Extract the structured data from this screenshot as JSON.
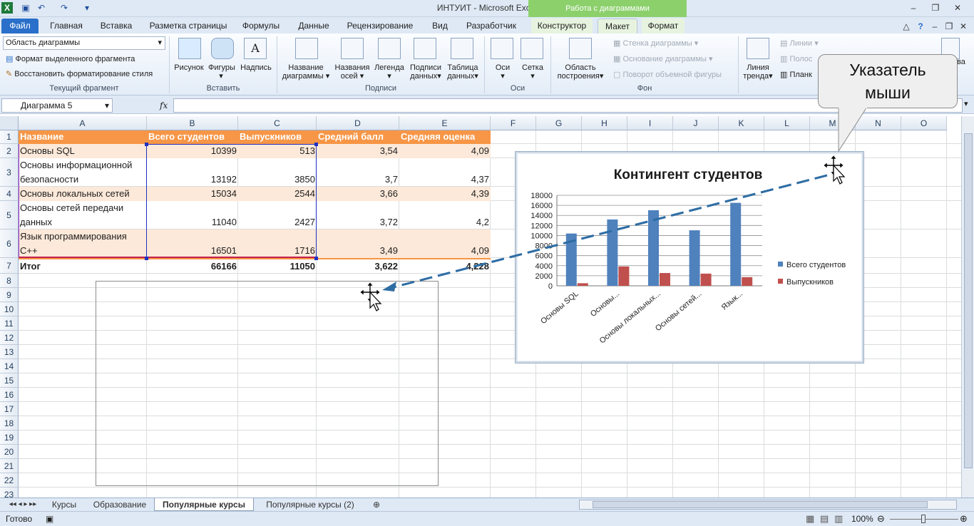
{
  "window": {
    "title": "ИНТУИТ  -  Microsoft Excel",
    "context_tool_title": "Работа с диаграммами"
  },
  "tabs": [
    "Файл",
    "Главная",
    "Вставка",
    "Разметка страницы",
    "Формулы",
    "Данные",
    "Рецензирование",
    "Вид",
    "Разработчик",
    "Конструктор",
    "Макет",
    "Формат"
  ],
  "active_tab": "Макет",
  "ribbon": {
    "current_fragment": {
      "selector_value": "Область диаграммы",
      "format_selection": "Формат выделенного фрагмента",
      "reset_style": "Восстановить форматирование стиля",
      "label": "Текущий фрагмент"
    },
    "insert": {
      "picture": "Рисунок",
      "shapes": "Фигуры",
      "textbox": "Надпись",
      "label": "Вставить"
    },
    "labels_group": {
      "chart_title_1": "Название",
      "chart_title_2": "диаграммы",
      "axis_titles_1": "Названия",
      "axis_titles_2": "осей",
      "legend": "Легенда",
      "data_labels_1": "Подписи",
      "data_labels_2": "данных",
      "data_table_1": "Таблица",
      "data_table_2": "данных",
      "label": "Подписи"
    },
    "axes_group": {
      "axes": "Оси",
      "gridlines": "Сетка",
      "label": "Оси"
    },
    "background_group": {
      "plot_area_1": "Область",
      "plot_area_2": "построения",
      "chart_wall": "Стенка диаграммы",
      "chart_floor": "Основание диаграммы",
      "rotation_3d": "Поворот объемной фигуры",
      "label": "Фон"
    },
    "analysis_group": {
      "trendline_1": "Линия",
      "trendline_2": "тренда",
      "lines": "Линии",
      "updown": "Полос",
      "errorbars": "Планк",
      "right_cut": "ва"
    }
  },
  "formula_bar": {
    "name_box": "Диаграмма 5",
    "fx": "fx",
    "formula": ""
  },
  "columns": [
    "A",
    "B",
    "C",
    "D",
    "E",
    "F",
    "G",
    "H",
    "I",
    "J",
    "K",
    "L",
    "M",
    "N",
    "O"
  ],
  "rows": [
    "1",
    "2",
    "3",
    "4",
    "5",
    "6",
    "7",
    "8",
    "9",
    "10",
    "11",
    "12",
    "13",
    "14",
    "15",
    "16",
    "17",
    "18",
    "19",
    "20",
    "21",
    "22",
    "23"
  ],
  "table": {
    "headers": [
      "Название",
      "Всего студентов",
      "Выпускников",
      "Средний балл",
      "Средняя оценка"
    ],
    "rows": [
      [
        "Основы SQL",
        "10399",
        "513",
        "3,54",
        "4,09"
      ],
      [
        "Основы информационной безопасности",
        "13192",
        "3850",
        "3,7",
        "4,37"
      ],
      [
        "Основы локальных сетей",
        "15034",
        "2544",
        "3,66",
        "4,39"
      ],
      [
        "Основы сетей передачи данных",
        "11040",
        "2427",
        "3,72",
        "4,2"
      ],
      [
        "Язык программирования C++",
        "16501",
        "1716",
        "3,49",
        "4,09"
      ]
    ],
    "row3_line1": "Основы информационной",
    "row3_line2": "безопасности",
    "row5_line1": "Основы сетей передачи",
    "row5_line2": "данных",
    "row6_line1": "Язык программирования",
    "row6_line2": "C++",
    "total": [
      "Итог",
      "66166",
      "11050",
      "3,622",
      "4,228"
    ]
  },
  "chart_data": {
    "type": "bar",
    "title": "Контингент студентов",
    "categories": [
      "Основы SQL",
      "Основы...",
      "Основы локальных...",
      "Основы сетей...",
      "Язык..."
    ],
    "series": [
      {
        "name": "Всего студентов",
        "values": [
          10399,
          13192,
          15034,
          11040,
          16501
        ],
        "color": "#4f81bd"
      },
      {
        "name": "Выпускников",
        "values": [
          513,
          3850,
          2544,
          2427,
          1716
        ],
        "color": "#c0504d"
      }
    ],
    "ylim": [
      0,
      18000
    ],
    "yticks": [
      "0",
      "2000",
      "4000",
      "6000",
      "8000",
      "10000",
      "12000",
      "14000",
      "16000",
      "18000"
    ],
    "legend": "right",
    "grid": true
  },
  "callout": {
    "line1": "Указатель",
    "line2": "мыши"
  },
  "sheet_tabs": [
    "Курсы",
    "Образование",
    "Популярные курсы",
    "Популярные курсы (2)"
  ],
  "active_sheet": "Популярные курсы",
  "status": {
    "ready": "Готово",
    "zoom": "100%"
  },
  "colors": {
    "header_fill": "#f79646",
    "band_fill": "#fde9d9",
    "accent": "#2a6fc9",
    "context_green": "#8cd06c"
  }
}
